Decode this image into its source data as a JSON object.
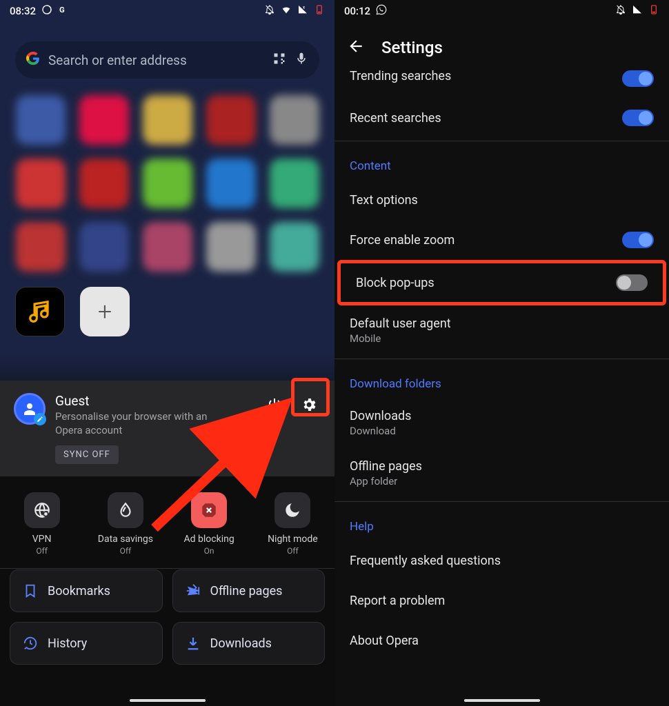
{
  "left": {
    "status": {
      "time": "08:32",
      "battery_low": true
    },
    "search": {
      "placeholder": "Search or enter address"
    },
    "account": {
      "name": "Guest",
      "desc": "Personalise your browser with an Opera account",
      "sync": "SYNC OFF"
    },
    "qa": [
      {
        "label": "VPN",
        "state": "Off"
      },
      {
        "label": "Data savings",
        "state": "Off"
      },
      {
        "label": "Ad blocking",
        "state": "On"
      },
      {
        "label": "Night mode",
        "state": "Off"
      }
    ],
    "bigbtns": [
      {
        "label": "Bookmarks"
      },
      {
        "label": "Offline pages"
      },
      {
        "label": "History"
      },
      {
        "label": "Downloads"
      }
    ]
  },
  "right": {
    "status": {
      "time": "00:12"
    },
    "title": "Settings",
    "partial_top": "Trending searches",
    "rows": {
      "recent": "Recent searches",
      "content_header": "Content",
      "text_options": "Text options",
      "force_zoom": "Force enable zoom",
      "block_popups": "Block pop-ups",
      "dua_label": "Default user agent",
      "dua_sub": "Mobile",
      "dl_header": "Download folders",
      "downloads_label": "Downloads",
      "downloads_sub": "Download",
      "offline_label": "Offline pages",
      "offline_sub": "App folder",
      "help_header": "Help",
      "faq": "Frequently asked questions",
      "report": "Report a problem",
      "about": "About Opera"
    }
  }
}
